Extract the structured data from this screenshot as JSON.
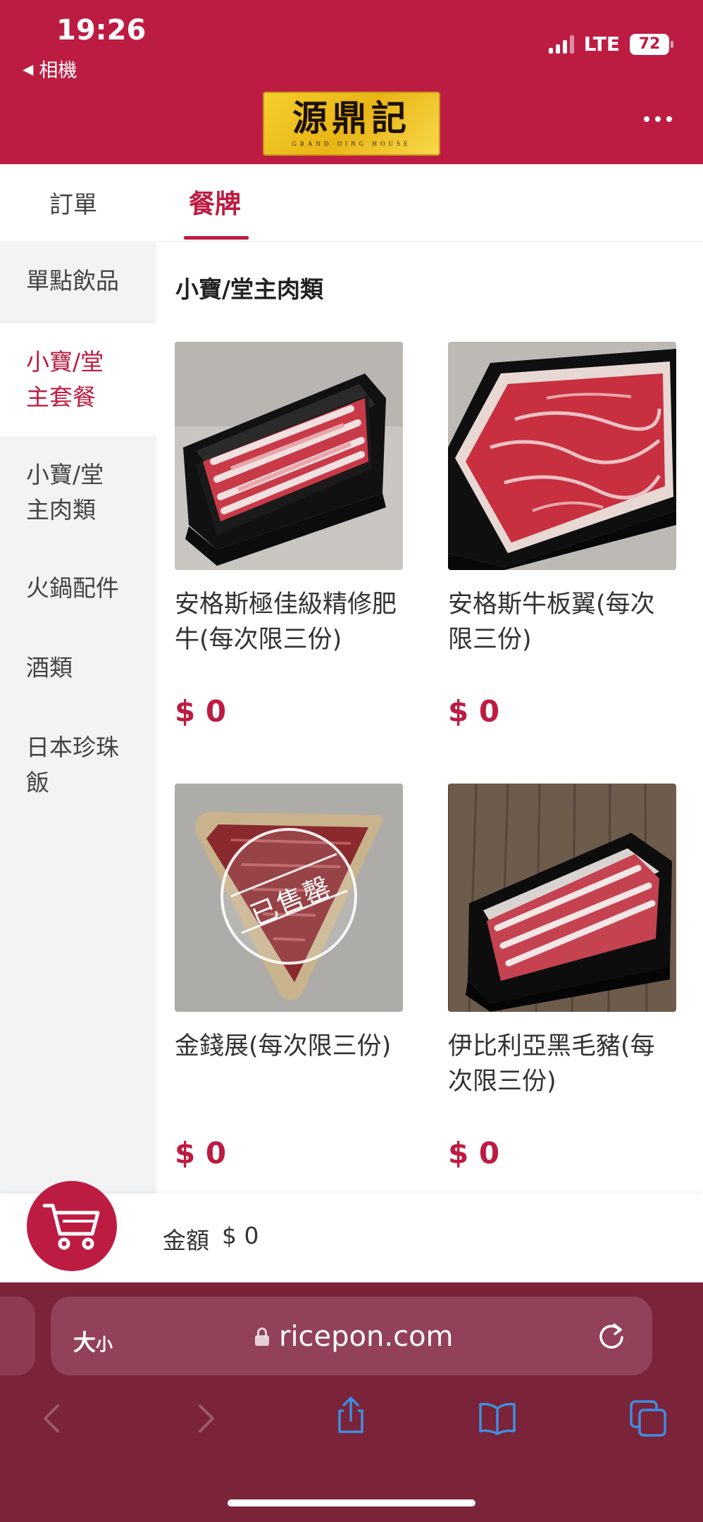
{
  "status_bar": {
    "time": "19:26",
    "back_label": "相機",
    "network": "LTE",
    "battery": "72"
  },
  "brand": {
    "logo_text_cn": "源鼎記",
    "logo_text_en": "GRAND DING HOUSE"
  },
  "tabs": [
    {
      "label": "訂單",
      "active": false
    },
    {
      "label": "餐牌",
      "active": true
    }
  ],
  "sidebar": {
    "items": [
      {
        "label": "單點飲品"
      },
      {
        "label": "小寶/堂主套餐",
        "active": true
      },
      {
        "label": "小寶/堂主肉類"
      },
      {
        "label": "火鍋配件"
      },
      {
        "label": "酒類"
      },
      {
        "label": "日本珍珠飯"
      }
    ]
  },
  "section_title": "小寶/堂主肉類",
  "products": [
    {
      "name": "安格斯極佳級精修肥牛(每次限三份)",
      "price": "$ 0",
      "sold_out": false
    },
    {
      "name": "安格斯牛板翼(每次限三份)",
      "price": "$ 0",
      "sold_out": false
    },
    {
      "name": "金錢展(每次限三份)",
      "price": "$ 0",
      "sold_out": true,
      "sold_out_label": "已售罄"
    },
    {
      "name": "伊比利亞黑毛豬(每次限三份)",
      "price": "$ 0",
      "sold_out": false
    }
  ],
  "cart": {
    "total_label": "金額",
    "total_value": "$ 0"
  },
  "browser": {
    "text_size_label": "大",
    "text_size_small": "小",
    "url": "ricepon.com"
  },
  "colors": {
    "brand_red": "#bd1c42",
    "safari_bar": "#7b2339",
    "browser_blue": "#3d8fe0"
  }
}
